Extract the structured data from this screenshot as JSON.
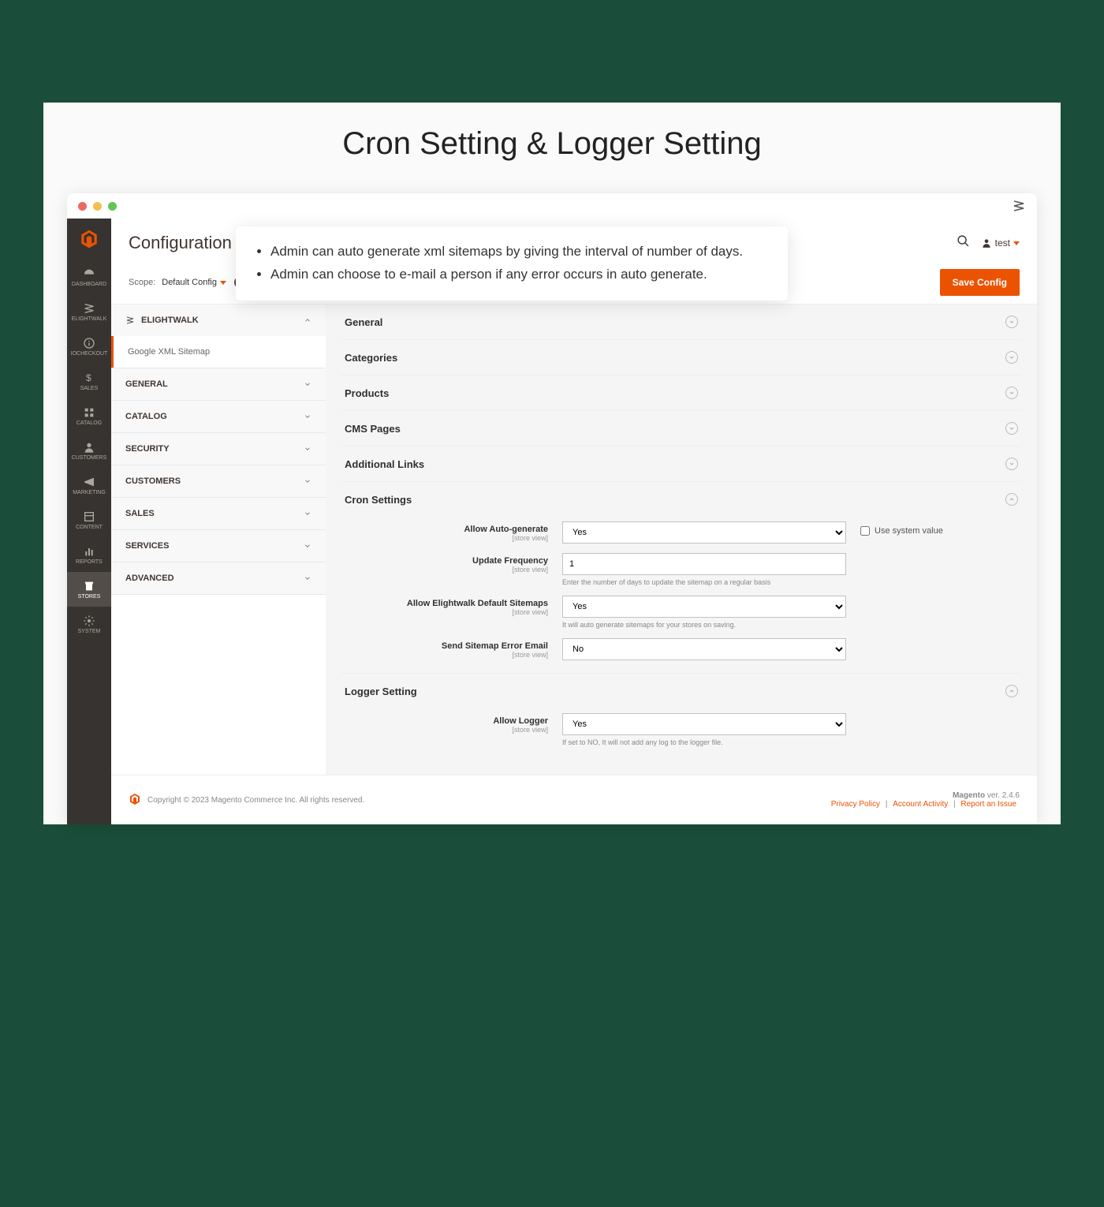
{
  "hero": "Cron Setting & Logger Setting",
  "callout": {
    "l1": "Admin can auto generate xml sitemaps by giving the interval of number of days.",
    "l2": "Admin can choose to e-mail a person if any error occurs in auto generate."
  },
  "page": {
    "title": "Configuration",
    "user": "test",
    "scope_label": "Scope:",
    "scope_value": "Default Config",
    "save": "Save Config"
  },
  "sidebar": {
    "items": [
      {
        "label": "Dashboard"
      },
      {
        "label": "Elightwalk"
      },
      {
        "label": "IOCheckout"
      },
      {
        "label": "Sales"
      },
      {
        "label": "Catalog"
      },
      {
        "label": "Customers"
      },
      {
        "label": "Marketing"
      },
      {
        "label": "Content"
      },
      {
        "label": "Reports"
      },
      {
        "label": "Stores"
      },
      {
        "label": "System"
      }
    ]
  },
  "tabs": {
    "brand": "ELIGHTWALK",
    "sub": "Google XML Sitemap",
    "groups": [
      "GENERAL",
      "CATALOG",
      "SECURITY",
      "CUSTOMERS",
      "SALES",
      "SERVICES",
      "ADVANCED"
    ]
  },
  "sections": {
    "s0": "General",
    "s1": "Categories",
    "s2": "Products",
    "s3": "CMS Pages",
    "s4": "Additional Links",
    "s5": "Cron Settings",
    "s6": "Logger Setting"
  },
  "fields": {
    "auto": {
      "label": "Allow Auto-generate",
      "scope": "[store view]",
      "value": "Yes",
      "use_sys": "Use system value"
    },
    "freq": {
      "label": "Update Frequency",
      "scope": "[store view]",
      "value": "1",
      "hint": "Enter the number of days to update the sitemap on a regular basis"
    },
    "default_sm": {
      "label": "Allow Elightwalk Default Sitemaps",
      "scope": "[store view]",
      "value": "Yes",
      "hint": "It will auto generate sitemaps for your stores on saving."
    },
    "err_email": {
      "label": "Send Sitemap Error Email",
      "scope": "[store view]",
      "value": "No"
    },
    "logger": {
      "label": "Allow Logger",
      "scope": "[store view]",
      "value": "Yes",
      "hint": "If set to NO, It will not add any log to the logger file."
    }
  },
  "footer": {
    "copy": "Copyright © 2023 Magento Commerce Inc. All rights reserved.",
    "ver_label": "Magento",
    "ver": " ver. 2.4.6",
    "links": {
      "privacy": "Privacy Policy",
      "activity": "Account Activity",
      "report": "Report an Issue"
    }
  }
}
